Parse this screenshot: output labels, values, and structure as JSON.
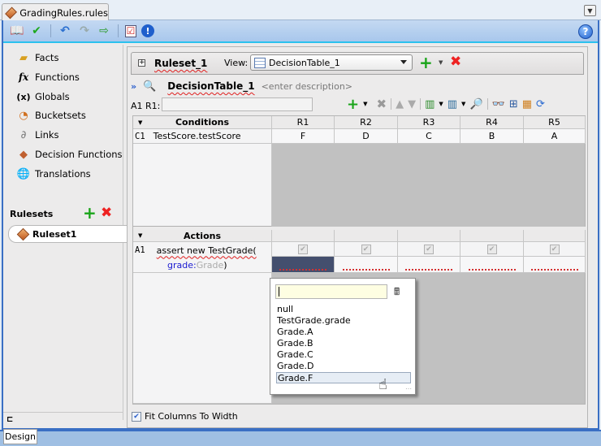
{
  "file_tab": {
    "title": "GradingRules.rules",
    "icon": "rules-diamond-icon"
  },
  "toolbar": {
    "icons": [
      "open-book-icon",
      "validate-check-icon",
      "undo-icon",
      "redo-icon",
      "import-icon",
      "checklist-icon",
      "info-icon"
    ],
    "help_label": "?"
  },
  "sidebar": {
    "items": [
      {
        "label": "Facts",
        "icon": "facts-icon"
      },
      {
        "label": "Functions",
        "icon": "fx-icon"
      },
      {
        "label": "Globals",
        "icon": "globals-icon"
      },
      {
        "label": "Bucketsets",
        "icon": "bucketsets-icon"
      },
      {
        "label": "Links",
        "icon": "links-icon"
      },
      {
        "label": "Decision Functions",
        "icon": "decision-functions-icon"
      },
      {
        "label": "Translations",
        "icon": "translations-icon"
      }
    ],
    "rulesets_header": "Rulesets",
    "rulesets": [
      {
        "label": "Ruleset1"
      }
    ]
  },
  "ruleset_bar": {
    "name": "Ruleset_1",
    "view_label": "View:",
    "view_value": "DecisionTable_1"
  },
  "decision_table": {
    "name": "DecisionTable_1",
    "description_placeholder": "<enter description>",
    "cell_label": "A1 R1:",
    "cell_value": ""
  },
  "table": {
    "conditions_header": "Conditions",
    "rule_headers": [
      "R1",
      "R2",
      "R3",
      "R4",
      "R5"
    ],
    "conditions": [
      {
        "id": "C1",
        "expr": "TestScore.testScore",
        "values": [
          "F",
          "D",
          "C",
          "B",
          "A"
        ]
      }
    ],
    "actions_header": "Actions",
    "actions": [
      {
        "id": "A1",
        "expr": "assert new TestGrade(",
        "param_name": "grade:",
        "param_type": "Grade",
        "close": ")",
        "checked": [
          true,
          true,
          true,
          true,
          true
        ]
      }
    ]
  },
  "popup": {
    "input_value": "",
    "options": [
      "null",
      "TestGrade.grade",
      "Grade.A",
      "Grade.B",
      "Grade.C",
      "Grade.D",
      "Grade.F"
    ],
    "selected": "Grade.F"
  },
  "fit_columns": {
    "label": "Fit Columns To Width",
    "checked": true
  },
  "bottom": {
    "design_tab": "Design"
  }
}
